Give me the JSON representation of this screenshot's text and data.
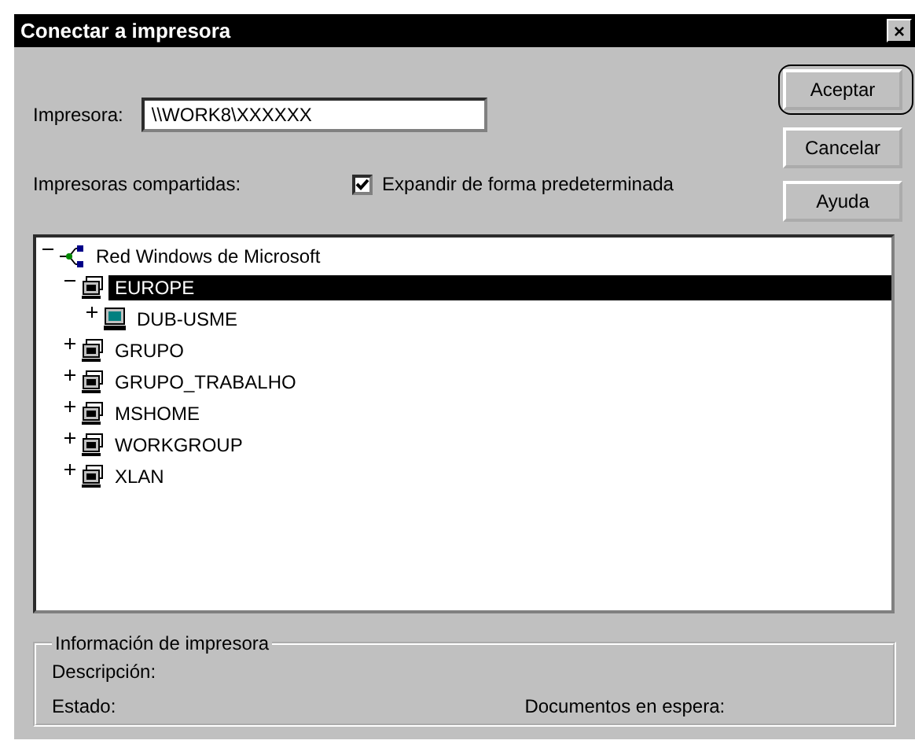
{
  "window": {
    "title": "Conectar a impresora",
    "close": "×"
  },
  "printer_field": {
    "label": "Impresora:",
    "value": "\\\\WORK8\\XXXXXX"
  },
  "buttons": [
    {
      "label": "Aceptar",
      "default": true
    },
    {
      "label": "Cancelar",
      "default": false
    },
    {
      "label": "Ayuda",
      "default": false
    }
  ],
  "shared_label": "Impresoras compartidas:",
  "expand_checkbox": {
    "label": "Expandir de forma predeterminada",
    "checked": true
  },
  "tree": [
    {
      "label": "Red Windows de Microsoft",
      "kind": "network",
      "expanded": true,
      "selected": false,
      "children": [
        {
          "label": "EUROPE",
          "kind": "workgroup",
          "expanded": true,
          "selected": true,
          "children": [
            {
              "label": "DUB-USME",
              "kind": "computer",
              "expanded": false,
              "selected": false
            }
          ]
        },
        {
          "label": "GRUPO",
          "kind": "workgroup",
          "expanded": false,
          "selected": false
        },
        {
          "label": "GRUPO_TRABALHO",
          "kind": "workgroup",
          "expanded": false,
          "selected": false
        },
        {
          "label": "MSHOME",
          "kind": "workgroup",
          "expanded": false,
          "selected": false
        },
        {
          "label": "WORKGROUP",
          "kind": "workgroup",
          "expanded": false,
          "selected": false
        },
        {
          "label": "XLAN",
          "kind": "workgroup",
          "expanded": false,
          "selected": false
        }
      ]
    }
  ],
  "info": {
    "title": "Información de impresora",
    "description_label": "Descripción:",
    "status_label": "Estado:",
    "queue_label": "Documentos en espera:"
  }
}
